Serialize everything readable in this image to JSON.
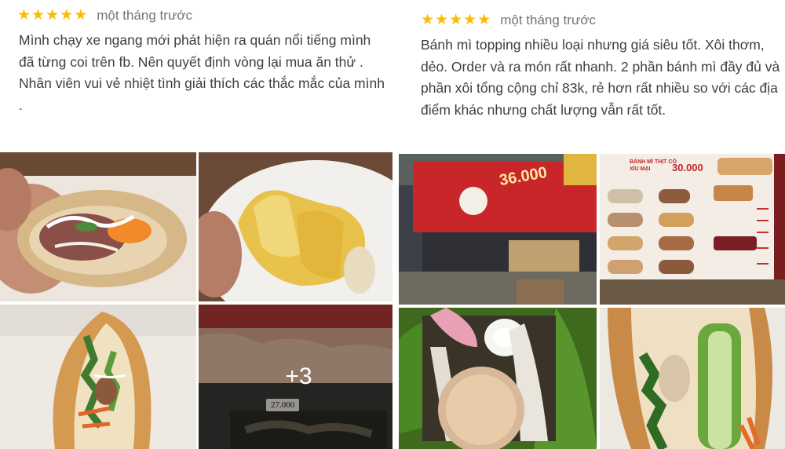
{
  "reviews": [
    {
      "rating": 5,
      "time": "một tháng trước",
      "paragraphs": [
        "Mình chạy xe ngang mới phát hiện ra quán nổi tiếng mình đã từng coi trên fb. Nên quyết định vòng lại mua ăn thử .",
        "Nhân viên vui vẻ nhiệt tình giải thích các thắc mắc của mình ."
      ],
      "photos": [
        {
          "name": "banh-mi-bitten-photo"
        },
        {
          "name": "xoi-sticky-rice-photo"
        },
        {
          "name": "banh-mi-herbs-photo"
        },
        {
          "name": "more-photos-tile",
          "more_label": "+3",
          "price_tag": "27.000"
        }
      ]
    },
    {
      "rating": 5,
      "time": "một tháng trước",
      "paragraphs": [
        "Bánh mì topping nhiều loại nhưng giá siêu tốt. Xôi thơm, dẻo. Order và ra món rất nhanh. 2 phần bánh mì đầy đủ và phần xôi tổng cộng chỉ 83k, rẻ hơn rất nhiều so với các địa điểm khác nhưng chất lượng vẫn rất tốt."
      ],
      "photos": [
        {
          "name": "storefront-photo",
          "sign_price": "36.000"
        },
        {
          "name": "menu-board-photo",
          "menu_title": "BÁNH MÌ THỊT CÓ XÍU MẠI",
          "menu_price": "30.000"
        },
        {
          "name": "xoi-egg-photo"
        },
        {
          "name": "banh-mi-cucumber-photo"
        }
      ]
    }
  ],
  "colors": {
    "star": "#fbbc04",
    "meta": "#70757a",
    "text": "#3c4043"
  }
}
